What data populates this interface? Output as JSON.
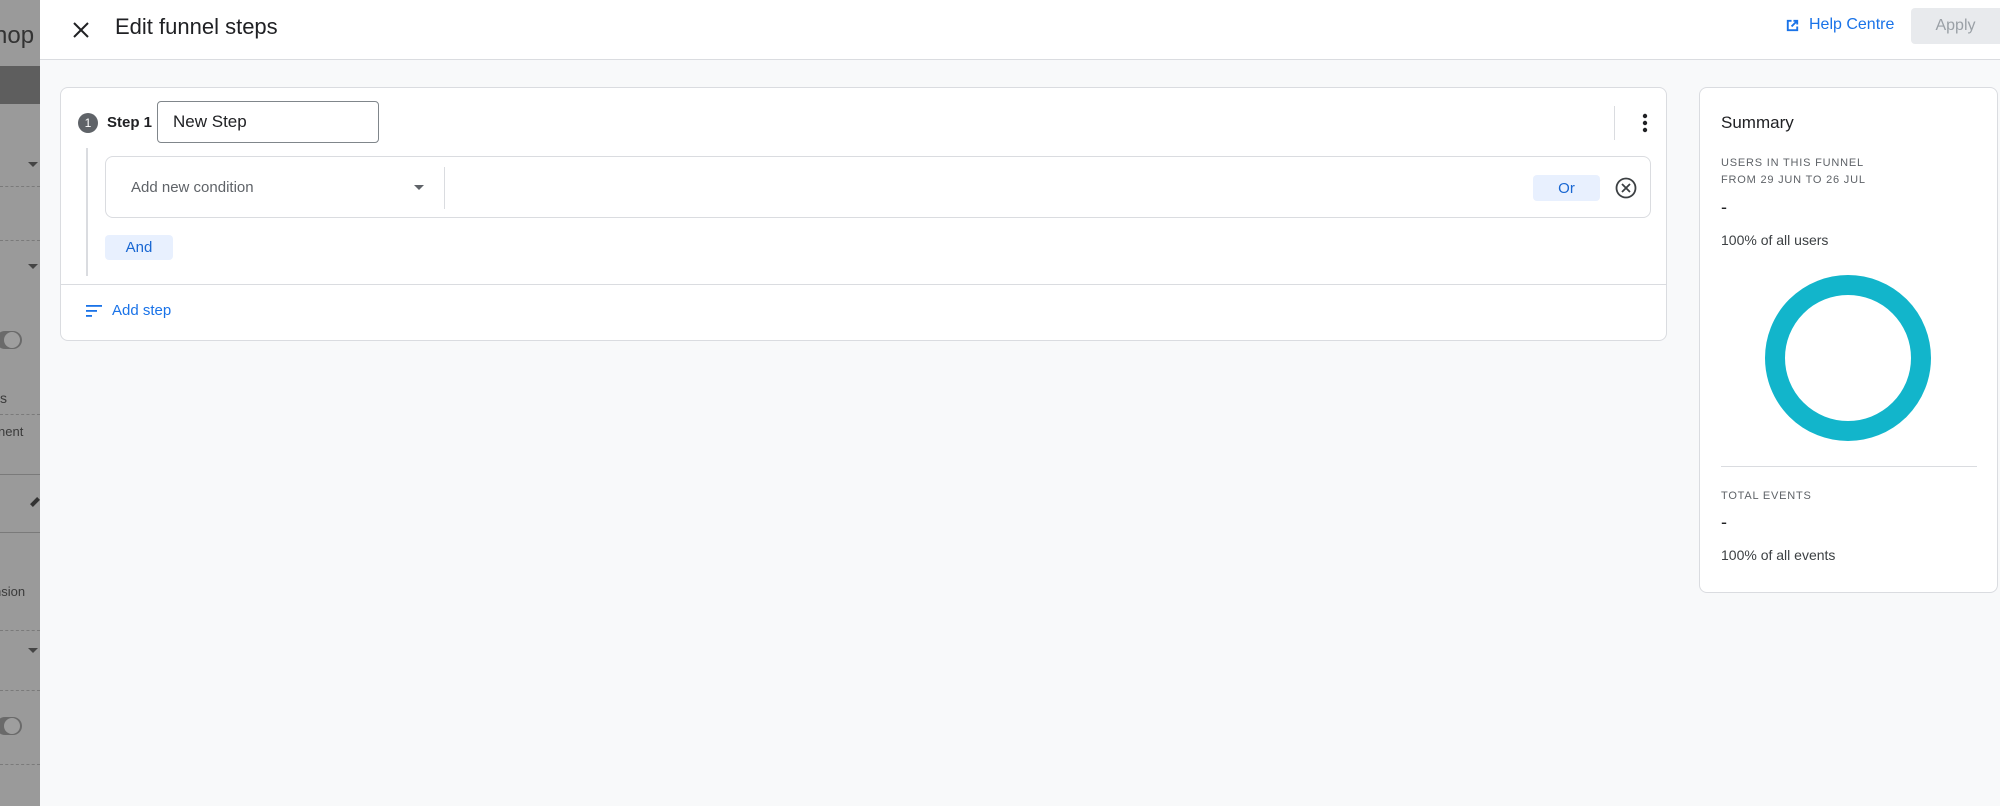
{
  "background": {
    "title_fragment": "hop",
    "text_fragment_1": "s",
    "text_fragment_2": "nent",
    "text_fragment_3": "nsion"
  },
  "header": {
    "title": "Edit funnel steps",
    "help_label": "Help Centre",
    "apply_label": "Apply"
  },
  "step": {
    "number": "1",
    "label": "Step 1",
    "name_value": "New Step",
    "condition_placeholder": "Add new condition",
    "or_label": "Or",
    "and_label": "And",
    "add_step_label": "Add step"
  },
  "summary": {
    "title": "Summary",
    "users_caption_line1": "USERS IN THIS FUNNEL",
    "users_caption_line2": "FROM 29 JUN TO 26 JUL",
    "users_value": "-",
    "users_percent": "100% of all users",
    "users_share": 1.0,
    "donut_color": "#12b5cb",
    "events_caption": "TOTAL EVENTS",
    "events_value": "-",
    "events_percent": "100% of all events"
  },
  "colors": {
    "accent": "#1a73e8",
    "chip_bg": "#e8f0fe",
    "border": "#dadce0"
  }
}
